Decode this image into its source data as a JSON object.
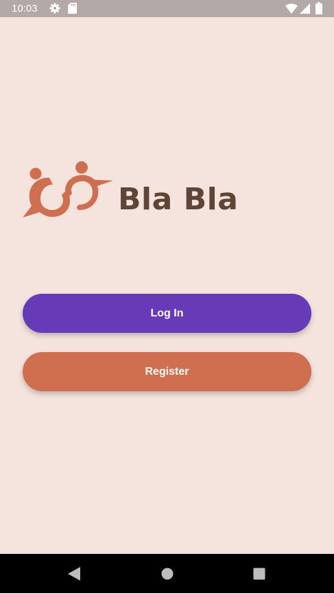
{
  "status_bar": {
    "time": "10:03",
    "icons": [
      "gear-icon",
      "sd-card-icon",
      "wifi-icon",
      "signal-icon",
      "battery-icon"
    ]
  },
  "brand": {
    "name": "Bla Bla",
    "text_color": "#5E4537",
    "logo_color": "#D06E50"
  },
  "buttons": {
    "login_label": "Log In",
    "register_label": "Register",
    "login_color": "#673AB7",
    "register_color": "#D06E50"
  },
  "nav_bar": {
    "icons": [
      "back-icon",
      "home-icon",
      "recents-icon"
    ]
  },
  "colors": {
    "background": "#F5E4DD",
    "status_bar": "#B3A9A6",
    "nav_bar": "#000000"
  }
}
